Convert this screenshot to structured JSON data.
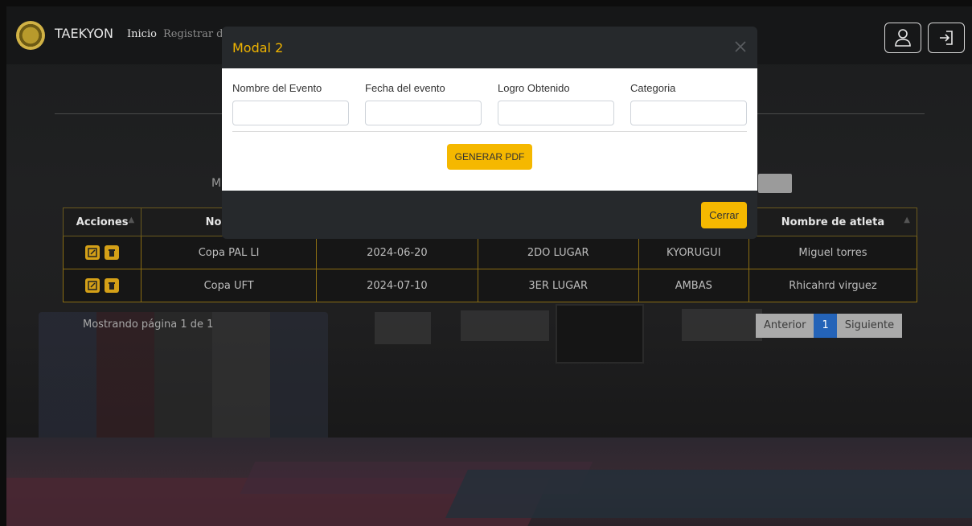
{
  "navbar": {
    "brand": "TAEKYON",
    "links": [
      "Inicio",
      "Registrar da"
    ]
  },
  "page": {
    "partial_label_left": "M",
    "table": {
      "headers": [
        "Acciones",
        "Nombre",
        "",
        "",
        "",
        "Nombre de atleta"
      ],
      "rows": [
        [
          "Copa PAL LI",
          "2024-06-20",
          "2DO LUGAR",
          "KYORUGUI",
          "Miguel torres"
        ],
        [
          "Copa UFT",
          "2024-07-10",
          "3ER LUGAR",
          "AMBAS",
          "Rhicahrd virguez"
        ]
      ]
    },
    "pagination": {
      "info": "Mostrando página 1 de 1",
      "prev": "Anterior",
      "current": "1",
      "next": "Siguiente"
    }
  },
  "modal": {
    "title": "Modal 2",
    "fields": [
      {
        "label": "Nombre del Evento",
        "value": ""
      },
      {
        "label": "Fecha del evento",
        "value": ""
      },
      {
        "label": "Logro Obtenido",
        "value": ""
      },
      {
        "label": "Categoria",
        "value": ""
      }
    ],
    "generate_label": "GENERAR PDF",
    "close_label": "Cerrar"
  },
  "colors": {
    "accent": "#f5b800",
    "modal_header": "#26292c",
    "table_border": "#8a6d12"
  },
  "icons": [
    "user-icon",
    "logout-icon",
    "close-icon",
    "edit-icon",
    "trash-icon",
    "logo-icon"
  ]
}
